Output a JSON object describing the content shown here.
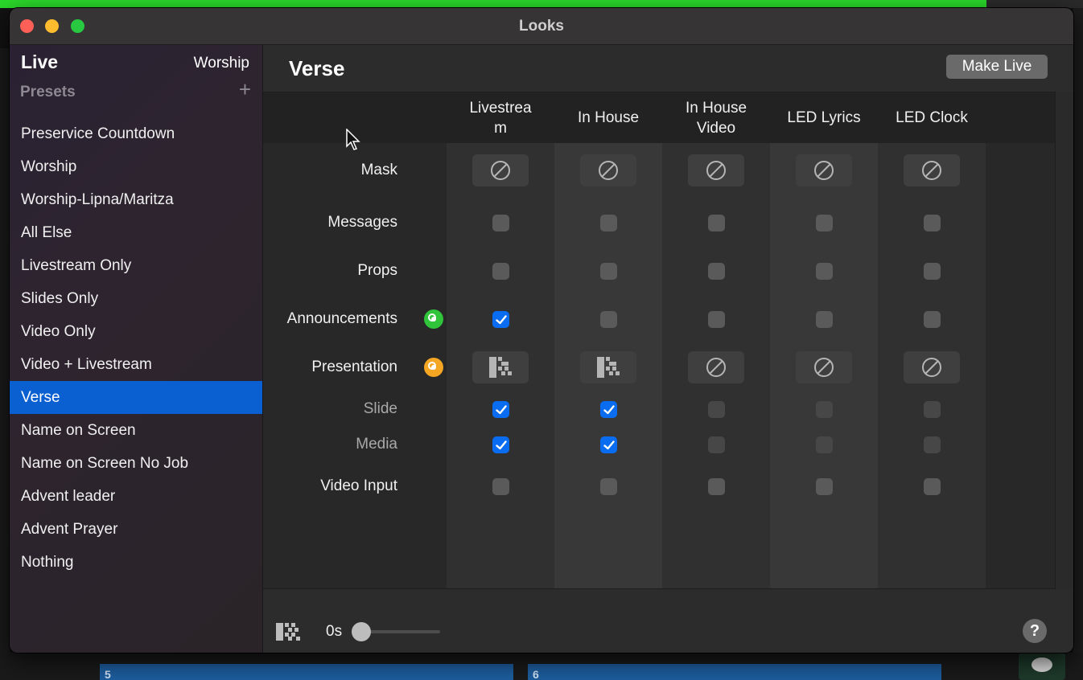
{
  "window": {
    "title": "Looks"
  },
  "sidebar": {
    "live_label": "Live",
    "live_value": "Worship",
    "presets_label": "Presets",
    "add_symbol": "+",
    "selected_index": 8,
    "presets": [
      "Preservice Countdown",
      "Worship",
      "Worship-Lipna/Maritza",
      "All Else",
      "Livestream Only",
      "Slides Only",
      "Video Only",
      "Video + Livestream",
      "Verse",
      "Name on Screen",
      "Name on Screen No Job",
      "Advent leader",
      "Advent Prayer",
      "Nothing"
    ]
  },
  "main": {
    "title": "Verse",
    "make_live_label": "Make Live",
    "columns": [
      "Livestrea\nm",
      "In House",
      "In House\nVideo",
      "LED Lyrics",
      "LED Clock"
    ],
    "rows": [
      {
        "label": "Mask",
        "kind": "button",
        "values": [
          "none",
          "none",
          "none",
          "none",
          "none"
        ]
      },
      {
        "label": "Messages",
        "kind": "checkbox",
        "values": [
          false,
          false,
          false,
          false,
          false
        ]
      },
      {
        "label": "Props",
        "kind": "checkbox",
        "values": [
          false,
          false,
          false,
          false,
          false
        ]
      },
      {
        "label": "Announcements",
        "kind": "checkbox",
        "indicator": "green-layer-icon",
        "values": [
          true,
          false,
          false,
          false,
          false
        ]
      },
      {
        "label": "Presentation",
        "kind": "button",
        "indicator": "orange-layer-icon",
        "values": [
          "transition",
          "transition",
          "none",
          "none",
          "none"
        ]
      },
      {
        "label": "Slide",
        "kind": "checkbox",
        "sub": true,
        "values": [
          true,
          true,
          false,
          false,
          false
        ]
      },
      {
        "label": "Media",
        "kind": "checkbox",
        "sub": true,
        "values": [
          true,
          true,
          false,
          false,
          false
        ]
      },
      {
        "label": "Video Input",
        "kind": "checkbox",
        "values": [
          false,
          false,
          false,
          false,
          false
        ]
      }
    ]
  },
  "footer": {
    "duration": "0s",
    "duration_fraction": 0,
    "help_symbol": "?"
  },
  "background": {
    "tile_a": "5",
    "tile_b": "6"
  },
  "colors": {
    "selection": "#0a5fd1",
    "checkbox_checked": "#0a6cf0",
    "announcements_indicator": "#2fc43a",
    "presentation_indicator": "#f5a623"
  }
}
